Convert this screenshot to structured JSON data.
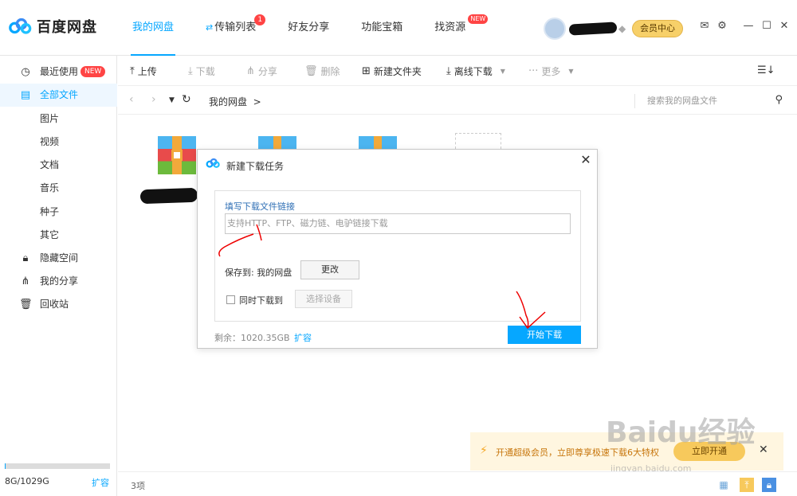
{
  "app": {
    "name": "百度网盘"
  },
  "nav": {
    "tabs": [
      {
        "label": "我的网盘"
      },
      {
        "label": "传输列表",
        "badge": "1"
      },
      {
        "label": "好友分享"
      },
      {
        "label": "功能宝箱"
      },
      {
        "label": "找资源",
        "badge": "NEW"
      }
    ],
    "vip_button": "会员中心"
  },
  "sidebar": {
    "items": [
      {
        "label": "最近使用",
        "badge": "NEW",
        "icon": "clock-icon"
      },
      {
        "label": "全部文件",
        "icon": "file-icon"
      },
      {
        "label": "图片"
      },
      {
        "label": "视频"
      },
      {
        "label": "文档"
      },
      {
        "label": "音乐"
      },
      {
        "label": "种子"
      },
      {
        "label": "其它"
      },
      {
        "label": "隐藏空间",
        "icon": "lock-icon"
      },
      {
        "label": "我的分享",
        "icon": "share-icon"
      },
      {
        "label": "回收站",
        "icon": "trash-icon"
      }
    ],
    "storage": {
      "text": "8G/1029G",
      "used_fraction": 0.008,
      "expand": "扩容"
    }
  },
  "toolbar": {
    "upload": "上传",
    "download": "下载",
    "share": "分享",
    "delete": "删除",
    "new_folder": "新建文件夹",
    "offline_download": "离线下载",
    "more": "更多"
  },
  "pathbar": {
    "crumb": "我的网盘",
    "search_placeholder": "搜索我的网盘文件"
  },
  "dialog": {
    "title": "新建下载任务",
    "link_label": "填写下载文件链接",
    "link_placeholder": "支持HTTP、FTP、磁力链、电驴链接下载",
    "save_to": "保存到: 我的网盘",
    "change_button": "更改",
    "simultaneous_label": "同时下载到",
    "select_device": "选择设备",
    "remaining": "剩余：1020.35GB",
    "expand": "扩容",
    "start_button": "开始下载"
  },
  "promo": {
    "text": "开通超级会员，立即尊享极速下载6大特权",
    "button": "立即开通"
  },
  "watermark": {
    "text": "Baidu经验",
    "sub": "jingyan.baidu.com"
  },
  "status": {
    "count": "3项"
  },
  "colors": {
    "accent": "#06a7ff",
    "badge": "#ff4444",
    "vip": "#f7d069"
  }
}
